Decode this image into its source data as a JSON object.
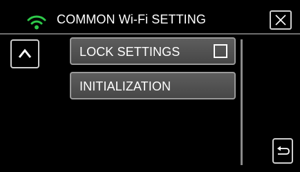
{
  "header": {
    "title": "COMMON Wi-Fi SETTING",
    "status_icon": "wifi-icon",
    "close_icon": "close-icon"
  },
  "navigation": {
    "up_icon": "chevron-up-icon",
    "back_icon": "return-arrow-icon"
  },
  "menu": {
    "items": [
      {
        "label": "LOCK SETTINGS",
        "checked": false
      },
      {
        "label": "INITIALIZATION"
      }
    ]
  },
  "colors": {
    "background": "#000000",
    "wifi_icon": "#2ec94a",
    "button_fill": "#555555",
    "border": "#cfcfcf",
    "text": "#ffffff"
  }
}
